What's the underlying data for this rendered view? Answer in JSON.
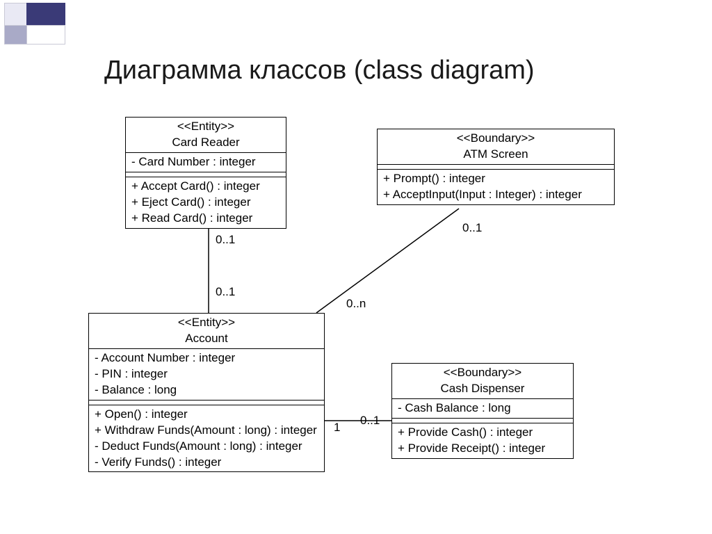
{
  "title": "Диаграмма классов (class diagram)",
  "classes": {
    "cardReader": {
      "stereotype": "<<Entity>>",
      "name": "Card Reader",
      "attributes": [
        "- Card Number : integer"
      ],
      "operations": [
        "+ Accept Card() : integer",
        "+ Eject Card() : integer",
        "+ Read Card() : integer"
      ]
    },
    "atmScreen": {
      "stereotype": "<<Boundary>>",
      "name": "ATM Screen",
      "attributes": [],
      "operations": [
        "+ Prompt() : integer",
        "+ AcceptInput(Input : Integer) : integer"
      ]
    },
    "account": {
      "stereotype": "<<Entity>>",
      "name": "Account",
      "attributes": [
        "- Account Number : integer",
        "- PIN : integer",
        "- Balance : long"
      ],
      "operations": [
        "+ Open() : integer",
        "+ Withdraw Funds(Amount : long) : integer",
        "- Deduct Funds(Amount : long) : integer",
        "- Verify Funds() : integer"
      ]
    },
    "cashDispenser": {
      "stereotype": "<<Boundary>>",
      "name": "Cash Dispenser",
      "attributes": [
        "- Cash Balance : long"
      ],
      "operations": [
        "+ Provide Cash() : integer",
        "+ Provide Receipt() : integer"
      ]
    }
  },
  "associations": {
    "cardReader_account": {
      "end1": "0..1",
      "end2": "0..1"
    },
    "atmScreen_account": {
      "end1": "0..1",
      "end2": "0..n"
    },
    "account_cashDispenser": {
      "end1": "1",
      "end2": "0..1"
    }
  }
}
